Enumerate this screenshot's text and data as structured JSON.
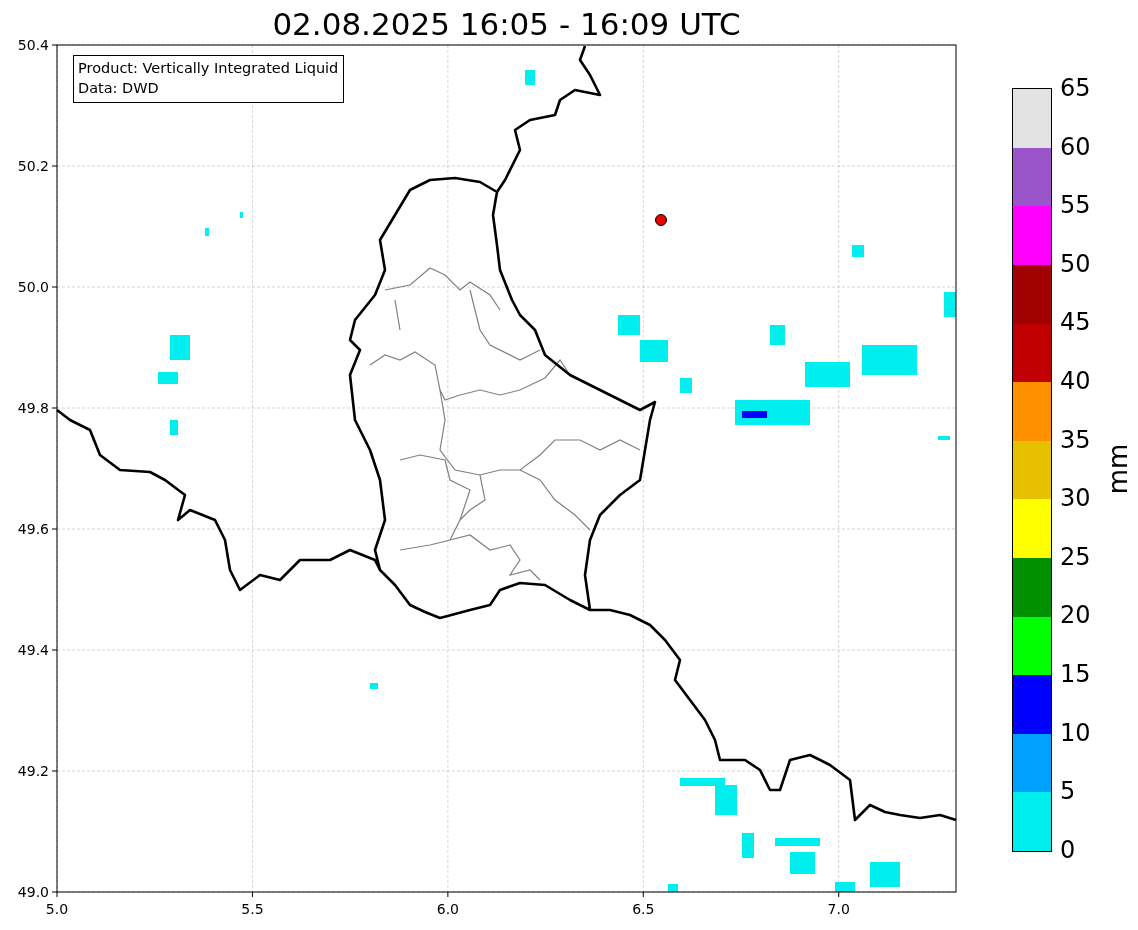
{
  "title": "02.08.2025 16:05 - 16:09 UTC",
  "info_box": {
    "lines": [
      "Product: Vertically Integrated Liquid",
      "Data: DWD"
    ]
  },
  "x_axis": {
    "ticks": [
      "5.0",
      "5.5",
      "6.0",
      "6.5",
      "7.0"
    ]
  },
  "y_axis": {
    "ticks": [
      "50.4",
      "50.2",
      "50.0",
      "49.8",
      "49.6",
      "49.4",
      "49.2",
      "49.0"
    ]
  },
  "colorbar": {
    "unit": "mm",
    "ticks": [
      "65",
      "60",
      "55",
      "50",
      "45",
      "40",
      "35",
      "30",
      "25",
      "20",
      "15",
      "10",
      "5",
      "0"
    ],
    "bins": [
      {
        "color": "#00eeee"
      },
      {
        "color": "#00a0ff"
      },
      {
        "color": "#0000ff"
      },
      {
        "color": "#00ff00"
      },
      {
        "color": "#009000"
      },
      {
        "color": "#ffff00"
      },
      {
        "color": "#e7c000"
      },
      {
        "color": "#ff9000"
      },
      {
        "color": "#c00000"
      },
      {
        "color": "#a00000"
      },
      {
        "color": "#ff00ff"
      },
      {
        "color": "#9955c9"
      },
      {
        "color": "#e3e3e3"
      }
    ]
  }
}
